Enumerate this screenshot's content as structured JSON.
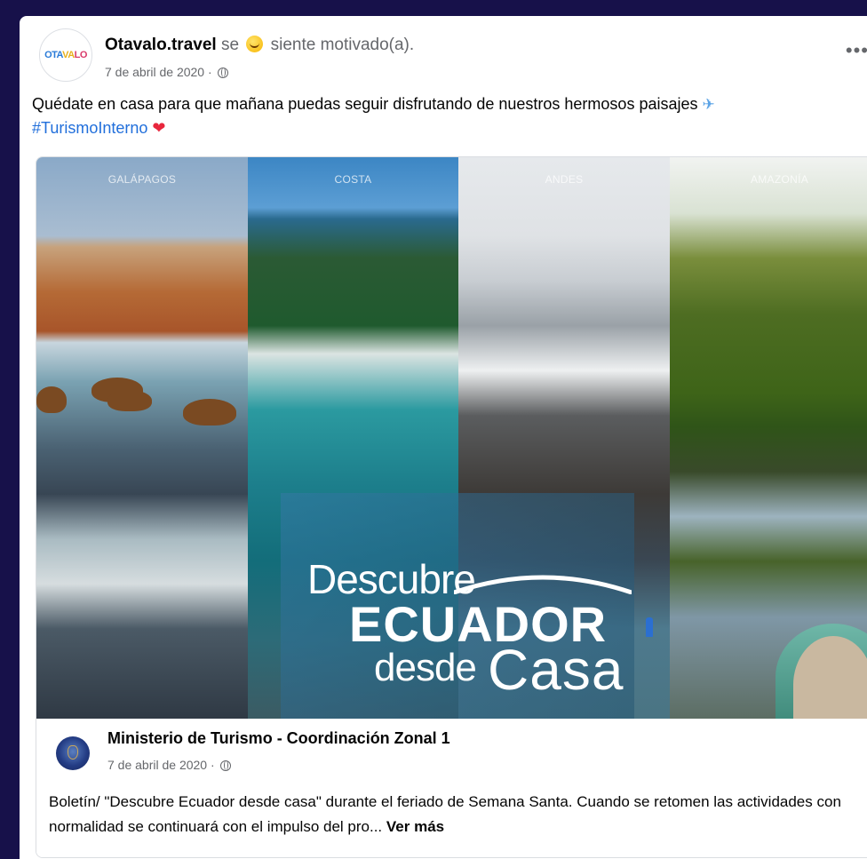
{
  "post": {
    "page_name": "Otavalo.travel",
    "feeling_prefix": "se",
    "feeling_text": "siente motivado(a).",
    "date": "7 de abril de 2020 ·",
    "more_label": "•••",
    "avatar_text_1": "OTA",
    "avatar_text_2": "VA",
    "avatar_text_3": "LO",
    "text_line": "Quédate en casa para que mañana puedas seguir disfrutando de nuestros hermosos paisajes",
    "plane_glyph": "✈",
    "hashtag": "#TurismoInterno",
    "heart_glyph": "❤"
  },
  "shared": {
    "panels": [
      "GALÁPAGOS",
      "COSTA",
      "ANDES",
      "AMAZONÍA"
    ],
    "logo": {
      "line1": "Descubre",
      "line2": "ECUADOR",
      "line3a": "desde",
      "line3b": "Casa"
    },
    "author": "Ministerio de Turismo - Coordinación Zonal 1",
    "date": "7 de abril de 2020 ·",
    "text": "Boletín/ \"Descubre Ecuador desde casa\" durante el feriado de Semana Santa. Cuando se retomen las actividades con normalidad se continuará con el impulso del pro...",
    "see_more": "Ver más"
  },
  "colors": {
    "background": "#17114a",
    "link": "#216fdb",
    "secondary_text": "#65676b"
  },
  "icons": {
    "feeling": "smiling-face-icon",
    "privacy": "globe-icon",
    "more": "more-options-icon",
    "plane": "airplane-icon",
    "heart": "heart-icon"
  }
}
